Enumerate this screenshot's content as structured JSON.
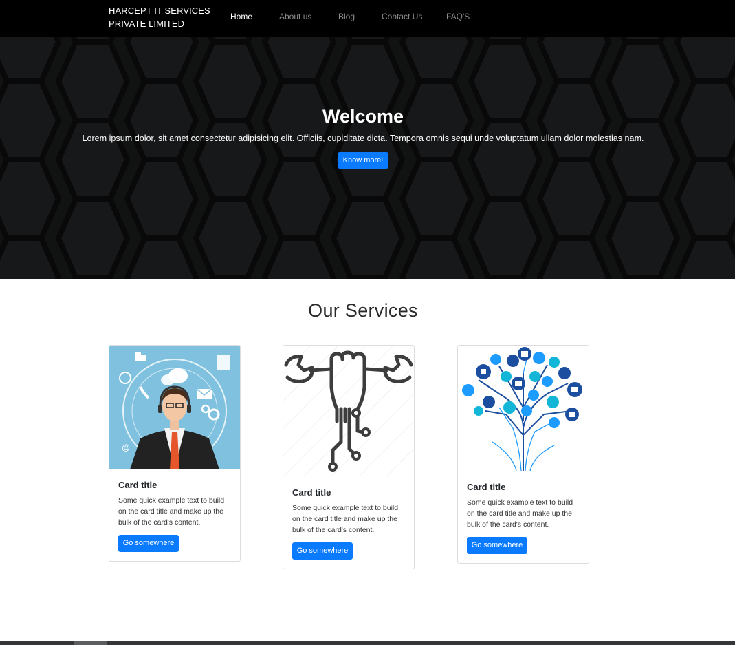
{
  "navbar": {
    "brand": "HARCEPT IT SERVICES PRIVATE LIMITED",
    "links": [
      {
        "label": "Home",
        "active": true
      },
      {
        "label": "About us",
        "active": false
      },
      {
        "label": "Blog",
        "active": false
      },
      {
        "label": "Contact Us",
        "active": false
      },
      {
        "label": "FAQ'S",
        "active": false
      }
    ]
  },
  "hero": {
    "title": "Welcome",
    "text": "Lorem ipsum dolor, sit amet consectetur adipisicing elit. Officiis, cupiditate dicta. Tempora omnis sequi unde voluptatum ullam dolor molestias nam.",
    "button": "Know more!",
    "accent_color": "#1e9bff",
    "background_color": "#1b1c1e"
  },
  "services": {
    "title": "Our Services",
    "cards": [
      {
        "image": "support-agent-illustration",
        "title": "Card title",
        "text": "Some quick example text to build on the card title and make up the bulk of the card's content.",
        "button": "Go somewhere"
      },
      {
        "image": "hand-wrench-circuit-icon",
        "title": "Card title",
        "text": "Some quick example text to build on the card title and make up the bulk of the card's content.",
        "button": "Go somewhere"
      },
      {
        "image": "technology-tree-illustration",
        "title": "Card title",
        "text": "Some quick example text to build on the card title and make up the bulk of the card's content.",
        "button": "Go somewhere"
      }
    ]
  },
  "colors": {
    "primary_button": "#0a7bff",
    "navbar": "#000000"
  }
}
